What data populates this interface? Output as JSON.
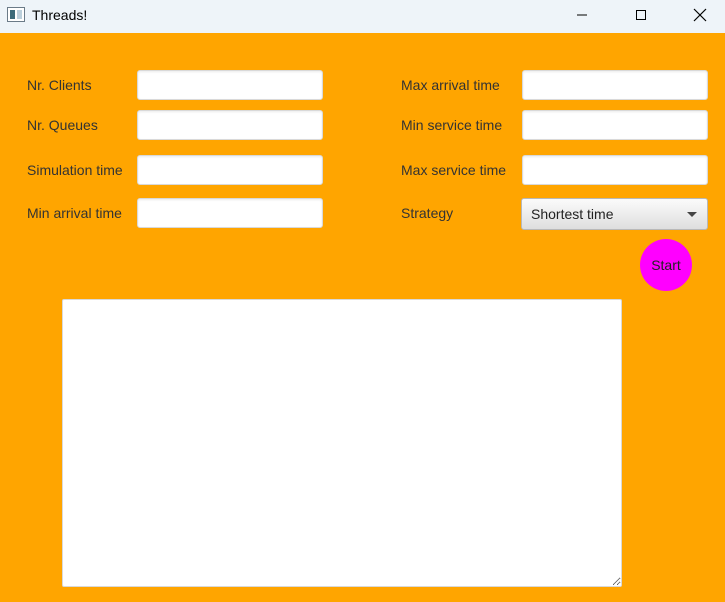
{
  "window": {
    "title": "Threads!"
  },
  "form": {
    "left": {
      "clients_label": "Nr. Clients",
      "queues_label": "Nr. Queues",
      "simulation_label": "Simulation time",
      "min_arrival_label": "Min arrival time"
    },
    "right": {
      "max_arrival_label": "Max arrival time",
      "min_service_label": "Min service time",
      "max_service_label": "Max service time",
      "strategy_label": "Strategy"
    },
    "values": {
      "clients": "",
      "queues": "",
      "simulation": "",
      "min_arrival": "",
      "max_arrival": "",
      "min_service": "",
      "max_service": ""
    },
    "strategy_selected": "Shortest time"
  },
  "start_label": "Start",
  "colors": {
    "background": "#ffa500",
    "start_button": "#ff00ff"
  }
}
